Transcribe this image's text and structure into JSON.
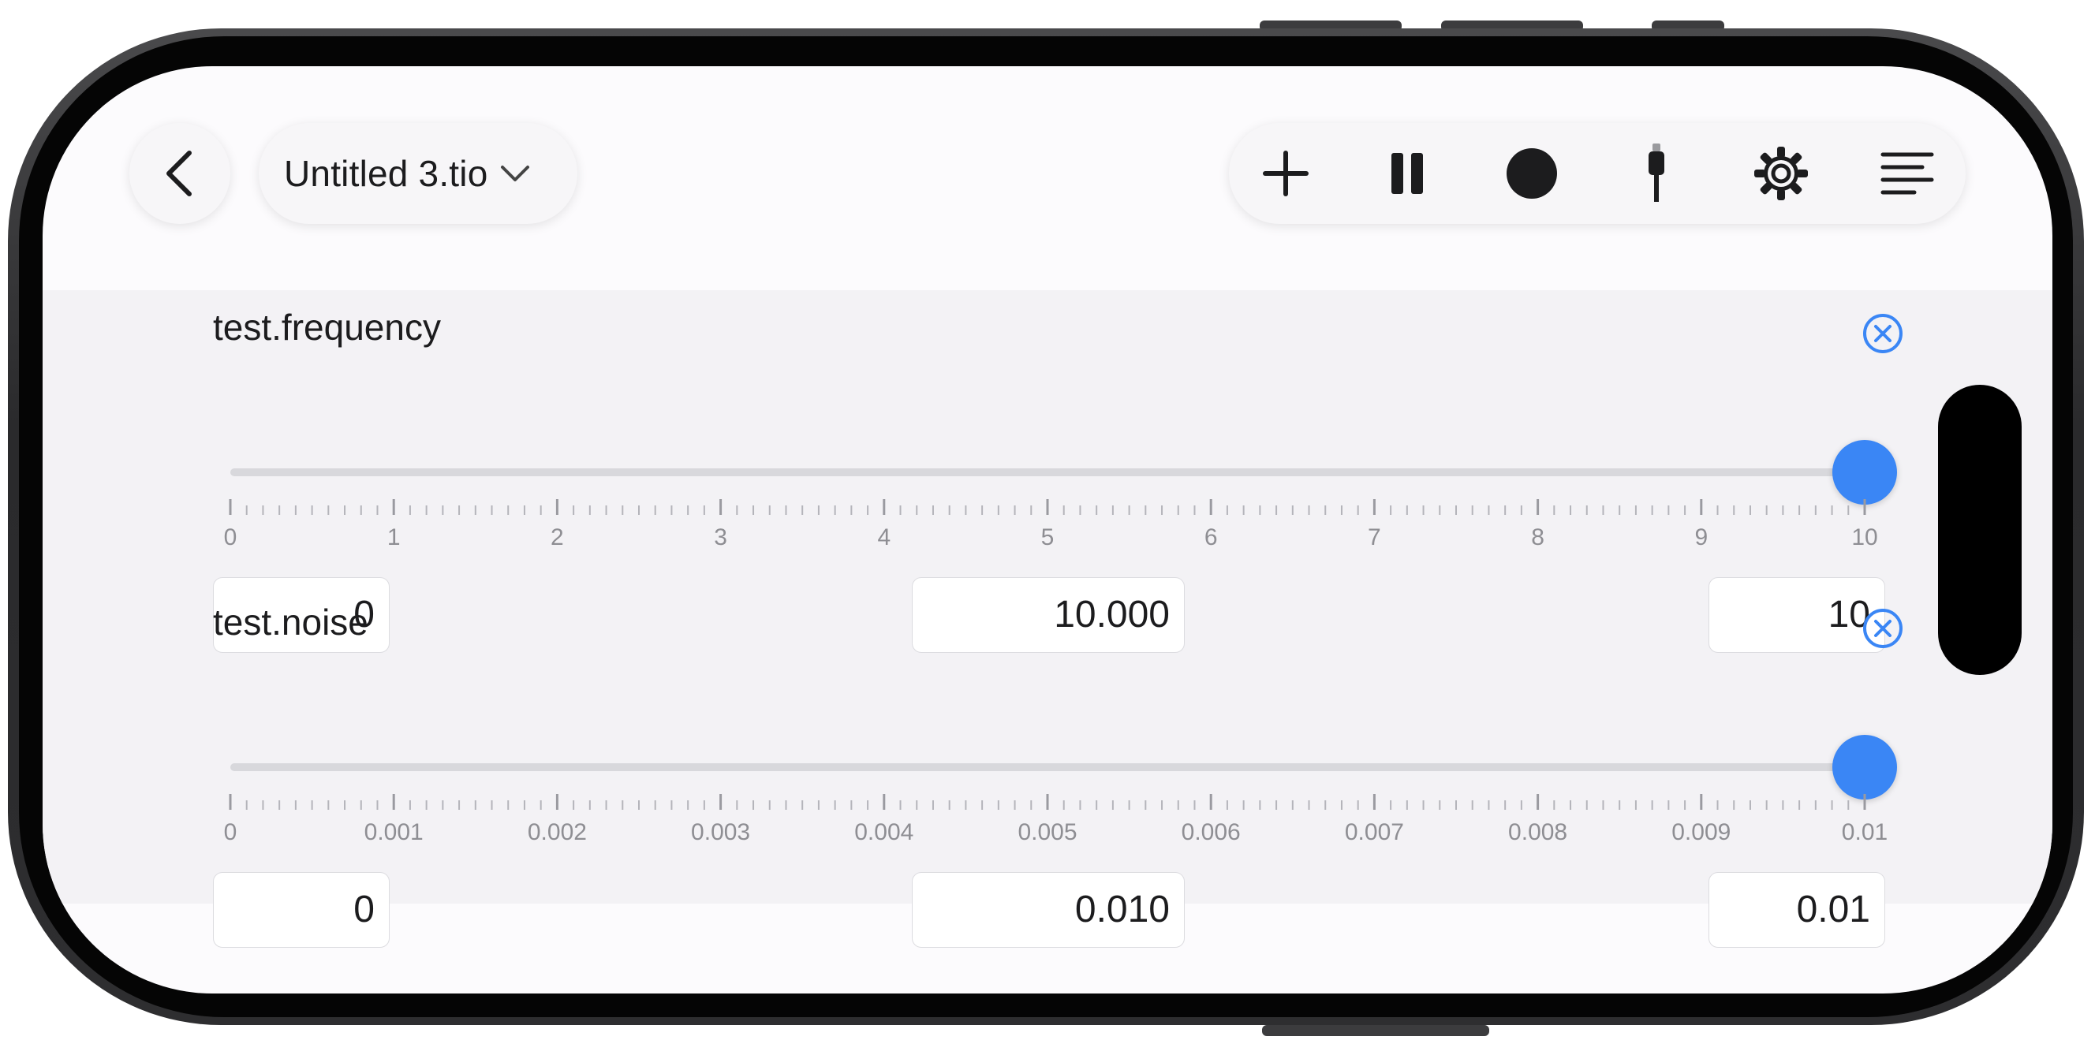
{
  "header": {
    "file_title": "Untitled 3.tio",
    "icons": [
      "back-chevron-icon",
      "chevron-down-icon",
      "plus-icon",
      "pause-icon",
      "record-icon",
      "usb-cable-icon",
      "gear-icon",
      "menu-lines-icon"
    ]
  },
  "colors": {
    "accent": "#3a86f5",
    "panel": "#f3f2f5",
    "track": "#d8d8dc"
  },
  "params": [
    {
      "name": "test.frequency",
      "value_fraction": 1.0,
      "ticks": [
        "0",
        "1",
        "2",
        "3",
        "4",
        "5",
        "6",
        "7",
        "8",
        "9",
        "10"
      ],
      "min": "0",
      "value": "10.000",
      "max": "10"
    },
    {
      "name": "test.noise",
      "value_fraction": 1.0,
      "ticks": [
        "0",
        "0.001",
        "0.002",
        "0.003",
        "0.004",
        "0.005",
        "0.006",
        "0.007",
        "0.008",
        "0.009",
        "0.01"
      ],
      "min": "0",
      "value": "0.010",
      "max": "0.01"
    }
  ]
}
